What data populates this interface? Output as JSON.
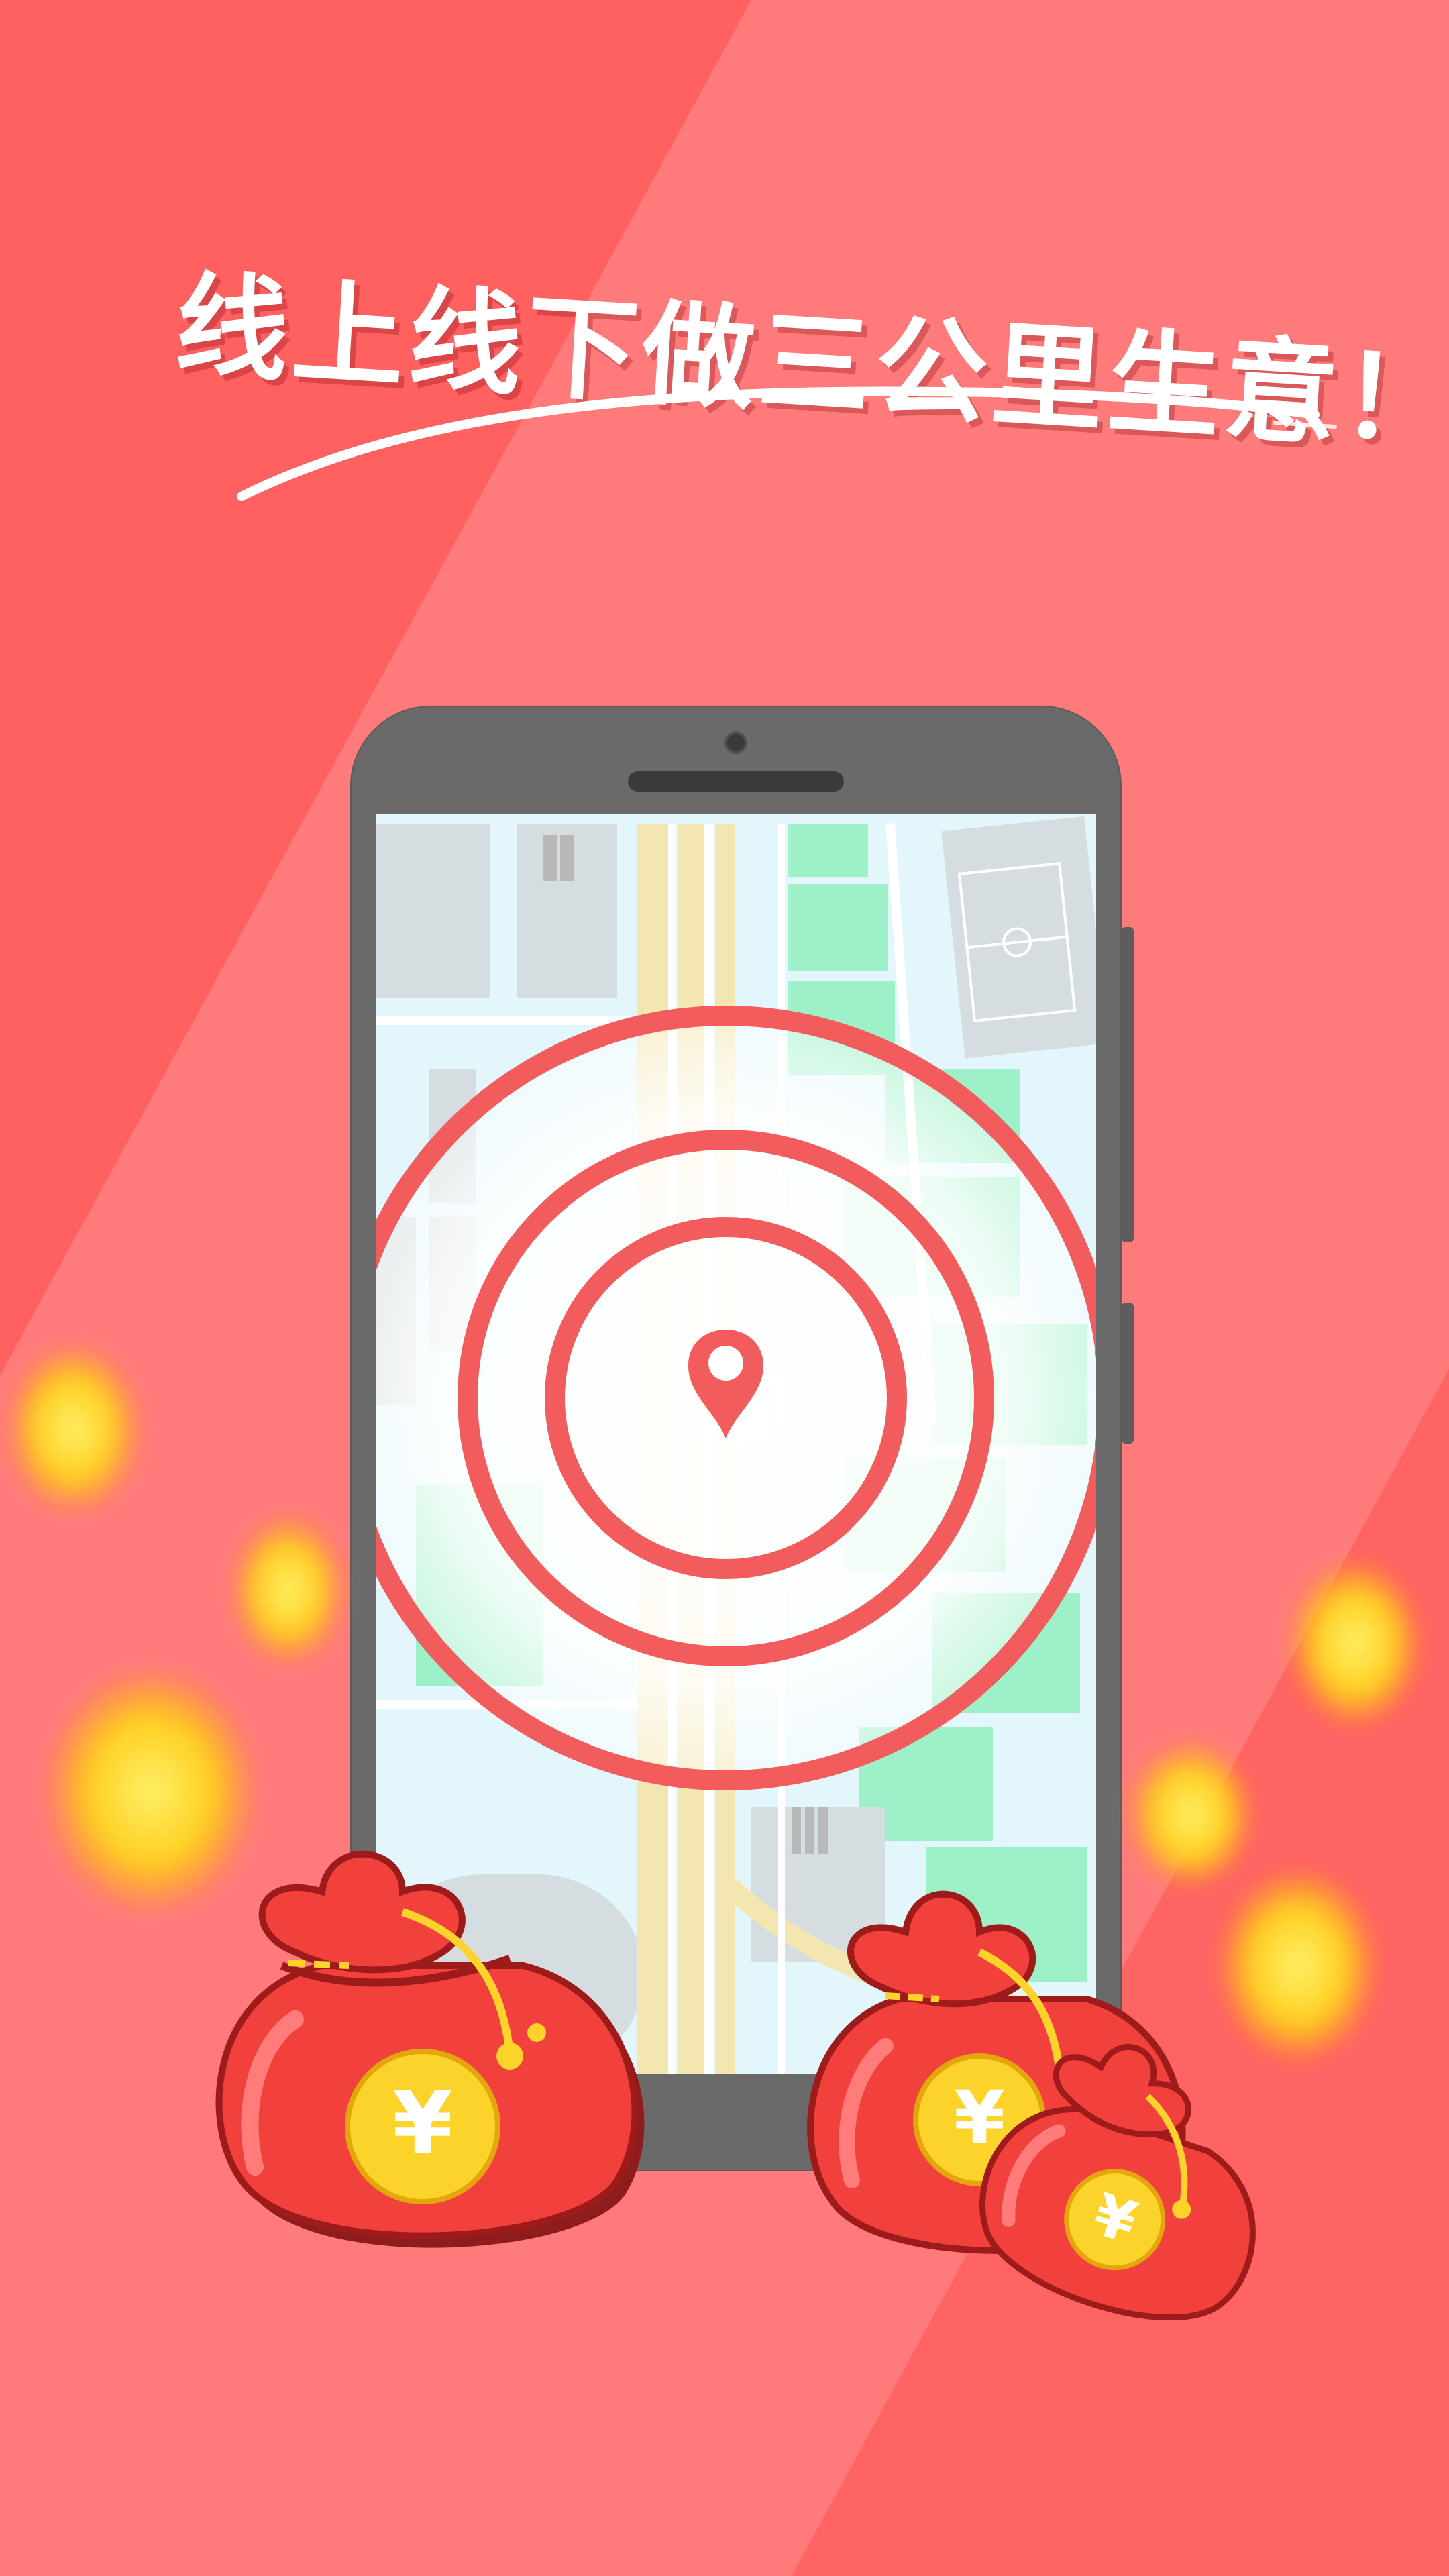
{
  "headline": {
    "text": "线上线下做三公里生意！"
  },
  "colors": {
    "background": "#ff7b7b",
    "band_dark": "#ff5f5f",
    "phone_body": "#6a6a6a",
    "ring": "#f25c5c",
    "bag_red": "#f2403d",
    "coin_gold": "#fcd32a"
  },
  "icons": {
    "location": "map-pin-icon",
    "bag_symbol": "yuan-symbol"
  },
  "bag_symbol": "¥"
}
